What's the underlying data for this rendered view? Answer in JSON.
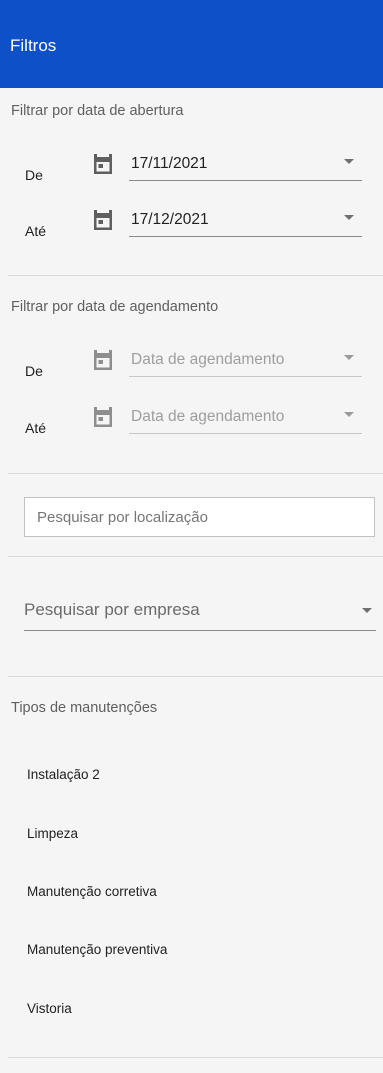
{
  "header": {
    "title": "Filtros"
  },
  "opening_filter": {
    "title": "Filtrar por data de abertura",
    "from": {
      "label": "De",
      "value": "17/11/2021"
    },
    "to": {
      "label": "Até",
      "value": "17/12/2021"
    }
  },
  "scheduling_filter": {
    "title": "Filtrar por data de agendamento",
    "from": {
      "label": "De",
      "placeholder": "Data de agendamento"
    },
    "to": {
      "label": "Até",
      "placeholder": "Data de agendamento"
    }
  },
  "location_search": {
    "placeholder": "Pesquisar por localização",
    "value": ""
  },
  "company_search": {
    "placeholder": "Pesquisar por empresa"
  },
  "maintenance_types": {
    "title": "Tipos de manutenções",
    "items": [
      "Instalação 2",
      "Limpeza",
      "Manutenção corretiva",
      "Manutenção preventiva",
      "Vistoria"
    ]
  },
  "colors": {
    "header_bg": "#0d50c8",
    "panel_bg": "#f5f5f5",
    "text": "#212121"
  },
  "icons": {
    "date_picker": "calendar-icon",
    "dropdown": "caret-down-icon"
  }
}
